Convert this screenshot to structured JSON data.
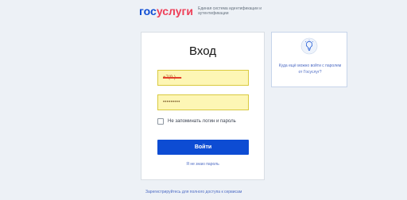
{
  "header": {
    "logo_part1": "гос",
    "logo_part2": "услуги",
    "tagline": "Единая система идентификации и аутентификации"
  },
  "login": {
    "title": "Вход",
    "login_value": "+7(9  )  -  -  ",
    "password_value": "•••••••••",
    "remember_label": "Не запоминать логин и пароль",
    "submit_label": "Войти",
    "forgot_link": "Я не знаю пароль"
  },
  "info": {
    "icon": "lightbulb-icon",
    "text": "Куда ещё можно войти с паролем от Госуслуг?"
  },
  "footer": {
    "register_link": "Зарегистрируйтесь для полного доступа к сервисам"
  },
  "colors": {
    "brand_blue": "#0d4cd3",
    "brand_red": "#ee3f58",
    "field_bg": "#fdf6b5",
    "link": "#4d6bc4"
  }
}
